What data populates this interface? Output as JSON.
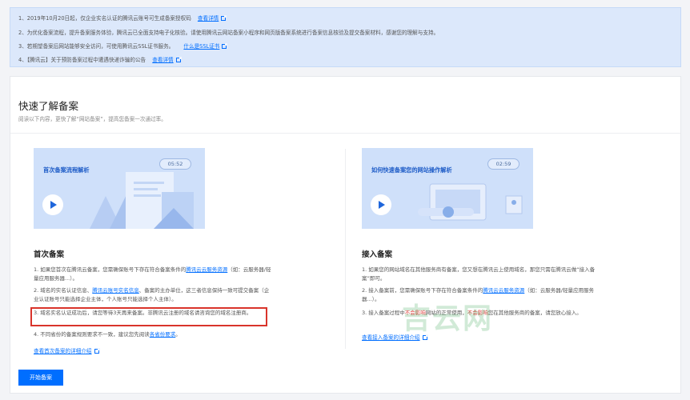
{
  "notices": [
    {
      "text": "1、2019年10月20日起，仅企业实名认证的腾讯云账号可生成备案授权码",
      "link": "查看详情",
      "has_ext": true
    },
    {
      "text": "2、为优化备案流程，提升备案服务体验，腾讯云已全面支持电子化核验。请使用腾讯云网站备案小程序和网页版备案系统进行备案信息核验及提交备案材料，感谢您的理解与支持。",
      "link": "",
      "has_ext": false
    },
    {
      "text": "3、若期望备案后网站能够安全访问，可使用腾讯云SSL证书服务。",
      "link": "什么是SSL证书",
      "has_ext": true
    },
    {
      "text": "4、【腾讯云】关于预防备案过程中遭遇快递诈骗的公告",
      "link": "查看详情",
      "has_ext": true
    }
  ],
  "section": {
    "title": "快速了解备案",
    "subtitle": "阅读以下内容，更快了解“网站备案”，提高您备案一次通过率。"
  },
  "left": {
    "video_title": "首次备案流程解析",
    "duration": "05:52",
    "heading": "首次备案",
    "p1_a": "1. 如果您首次在腾讯云备案，您需确保账号下存在符合备案条件的",
    "p1_link": "腾讯云云服务资源",
    "p1_b": "（如：云服务器/轻量应用服务器...）。",
    "p2_a": "2. 域名的实名认证信息、",
    "p2_link": "腾讯云账号实名信息",
    "p2_b": "、备案的主办单位，这三者信息保持一致可提交备案（企业认证账号只能选择企业主体，个人账号只能选择个人主体）。",
    "p3": "3. 域名实名认证成功后，请您等待3天再来备案。非腾讯云注册的域名请咨询您的域名注册商。",
    "p4_a": "4. 不同省份的备案规则要求不一致，建议您先阅读",
    "p4_link": "各省份要求",
    "p4_b": "。",
    "detail": "查看首次备案的详细介绍"
  },
  "right": {
    "video_title": "如何快速备案您的网站操作解析",
    "duration": "02:59",
    "heading": "接入备案",
    "p1": "1. 如果您的网站域名在其他服务商有备案，您又想在腾讯云上使用域名，那您只需在腾讯云做“接入备案”即可。",
    "p1_link": "接入备案",
    "p2_a": "2. 接入备案前，您需确保账号下存在符合备案条件的",
    "p2_link": "腾讯云云服务资源",
    "p2_b": "（如：云服务器/轻量应用服务器...）。",
    "p3_a": "3. 接入备案过程中",
    "p3_red1": "不会影响",
    "p3_b": "网站的正常使用，",
    "p3_red2": "不会影响",
    "p3_c": "您在其他服务商的备案，请您放心接入。",
    "detail": "查看接入备案的详细介绍"
  },
  "start_button": "开始备案",
  "watermark": "吉云网",
  "colors": {
    "accent": "#006eff",
    "highlight": "#d9342b",
    "notice_bg": "#dce8fb",
    "video_bg": "#cfe0fa"
  },
  "icons": [
    "external-link-icon",
    "play-icon"
  ]
}
